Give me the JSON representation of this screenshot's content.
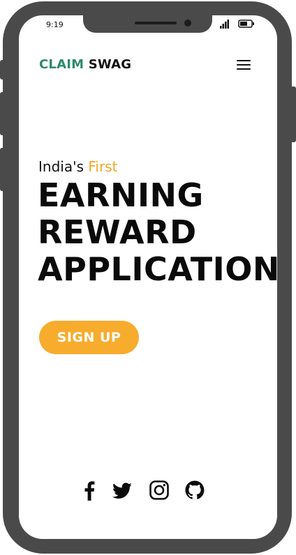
{
  "status_bar": {
    "time": "9:19",
    "icons": [
      "signal-icon",
      "battery-icon"
    ]
  },
  "navbar": {
    "brand_part1": "CLAIM",
    "brand_part2": " SWAG",
    "menu_icon": "hamburger-menu-icon"
  },
  "hero": {
    "subtitle_prefix": "India's ",
    "subtitle_accent": "First",
    "title_lines": [
      "EARNING",
      "REWARD",
      "APPLICATION"
    ]
  },
  "cta": {
    "signup_label": "SIGN UP"
  },
  "social": {
    "links": [
      "facebook-icon",
      "twitter-icon",
      "instagram-icon",
      "github-icon"
    ]
  },
  "colors": {
    "brand_green": "#2e8b6b",
    "accent_orange": "#f5a623",
    "button_orange": "#f8ac2e",
    "frame_gray": "#4a4a4a",
    "text_dark": "#0a0a0a"
  }
}
